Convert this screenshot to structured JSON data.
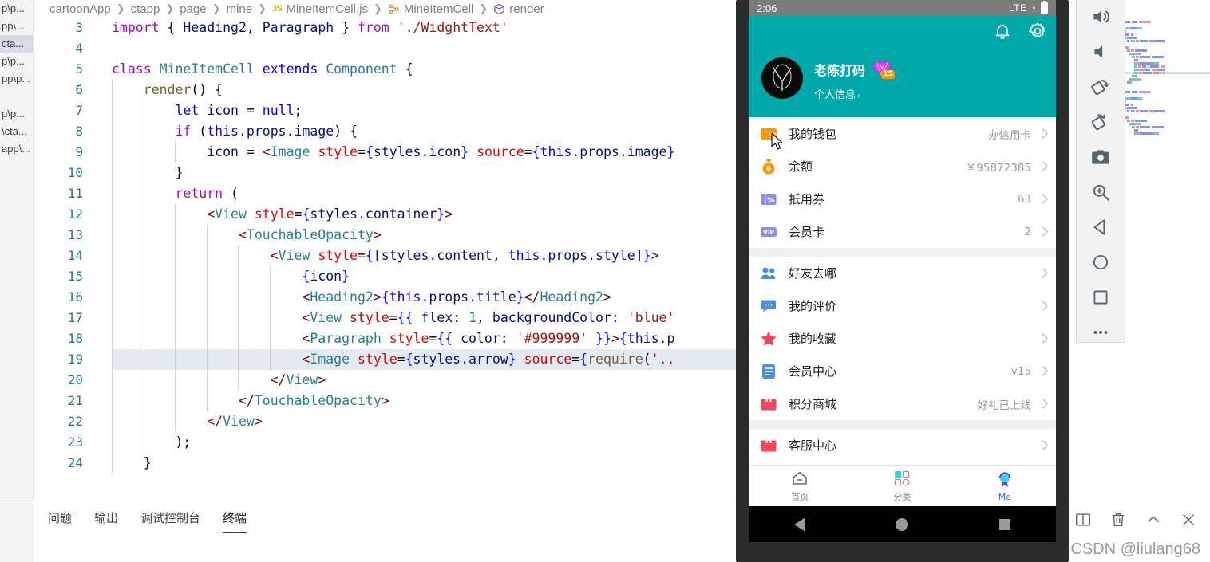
{
  "editor": {
    "breadcrumb": [
      {
        "label": "cartoonApp",
        "icon": ""
      },
      {
        "label": "ctapp",
        "icon": ""
      },
      {
        "label": "page",
        "icon": ""
      },
      {
        "label": "mine",
        "icon": ""
      },
      {
        "label": "MineItemCell.js",
        "icon": "js-file-icon"
      },
      {
        "label": "MineItemCell",
        "icon": "class-icon"
      },
      {
        "label": "render",
        "icon": "method-icon"
      }
    ],
    "explorer_items": [
      {
        "label": "p\\p...",
        "selected": false
      },
      {
        "label": "pp\\...",
        "selected": false
      },
      {
        "label": "cta...",
        "selected": true
      },
      {
        "label": "p\\p...",
        "selected": false
      },
      {
        "label": "pp\\p...",
        "selected": false
      },
      {
        "label": "",
        "selected": false
      },
      {
        "label": "p\\p...",
        "selected": false
      },
      {
        "label": "\\cta...",
        "selected": false
      },
      {
        "label": "app\\...",
        "selected": false
      }
    ],
    "lines": [
      {
        "num": "3",
        "indent": 0,
        "highlight": false,
        "tokens": [
          {
            "t": "import ",
            "c": "t-kw"
          },
          {
            "t": "{ ",
            "c": "t-plain"
          },
          {
            "t": "Heading2",
            "c": "t-ident"
          },
          {
            "t": ", ",
            "c": "t-plain"
          },
          {
            "t": "Paragraph",
            "c": "t-ident"
          },
          {
            "t": " } ",
            "c": "t-plain"
          },
          {
            "t": "from ",
            "c": "t-kw"
          },
          {
            "t": "'./WidghtText'",
            "c": "t-str"
          }
        ]
      },
      {
        "num": "4",
        "indent": 0,
        "highlight": false,
        "tokens": []
      },
      {
        "num": "5",
        "indent": 0,
        "highlight": false,
        "tokens": [
          {
            "t": "class ",
            "c": "t-kw"
          },
          {
            "t": "MineItemCell",
            "c": "t-type"
          },
          {
            "t": " extends ",
            "c": "t-kw2"
          },
          {
            "t": "Component",
            "c": "t-type"
          },
          {
            "t": " {",
            "c": "t-plain"
          }
        ]
      },
      {
        "num": "6",
        "indent": 1,
        "highlight": false,
        "tokens": [
          {
            "t": "    ",
            "c": "t-plain"
          },
          {
            "t": "render",
            "c": "t-fn"
          },
          {
            "t": "() {",
            "c": "t-plain"
          }
        ]
      },
      {
        "num": "7",
        "indent": 2,
        "highlight": false,
        "tokens": [
          {
            "t": "        ",
            "c": "t-plain"
          },
          {
            "t": "let ",
            "c": "t-blue"
          },
          {
            "t": "icon",
            "c": "t-ident"
          },
          {
            "t": " = ",
            "c": "t-plain"
          },
          {
            "t": "null",
            "c": "t-blue"
          },
          {
            "t": ";",
            "c": "t-plain"
          }
        ]
      },
      {
        "num": "8",
        "indent": 2,
        "highlight": false,
        "tokens": [
          {
            "t": "        ",
            "c": "t-plain"
          },
          {
            "t": "if ",
            "c": "t-kw"
          },
          {
            "t": "(",
            "c": "t-plain"
          },
          {
            "t": "this",
            "c": "t-blue"
          },
          {
            "t": ".props.image",
            "c": "t-ident"
          },
          {
            "t": ") {",
            "c": "t-plain"
          }
        ]
      },
      {
        "num": "9",
        "indent": 3,
        "highlight": false,
        "tokens": [
          {
            "t": "            ",
            "c": "t-plain"
          },
          {
            "t": "icon",
            "c": "t-ident"
          },
          {
            "t": " = ",
            "c": "t-plain"
          },
          {
            "t": "<",
            "c": "t-bracket"
          },
          {
            "t": "Image",
            "c": "t-tag"
          },
          {
            "t": " ",
            "c": "t-plain"
          },
          {
            "t": "style",
            "c": "t-attr"
          },
          {
            "t": "=",
            "c": "t-plain"
          },
          {
            "t": "{",
            "c": "t-blue"
          },
          {
            "t": "styles.icon",
            "c": "t-ident"
          },
          {
            "t": "}",
            "c": "t-blue"
          },
          {
            "t": " ",
            "c": "t-plain"
          },
          {
            "t": "source",
            "c": "t-attr"
          },
          {
            "t": "=",
            "c": "t-plain"
          },
          {
            "t": "{",
            "c": "t-blue"
          },
          {
            "t": "this",
            "c": "t-blue"
          },
          {
            "t": ".props.image",
            "c": "t-ident"
          },
          {
            "t": "}",
            "c": "t-blue"
          }
        ]
      },
      {
        "num": "10",
        "indent": 2,
        "highlight": false,
        "tokens": [
          {
            "t": "        }",
            "c": "t-plain"
          }
        ]
      },
      {
        "num": "11",
        "indent": 2,
        "highlight": false,
        "tokens": [
          {
            "t": "        ",
            "c": "t-plain"
          },
          {
            "t": "return ",
            "c": "t-kw"
          },
          {
            "t": "(",
            "c": "t-plain"
          }
        ]
      },
      {
        "num": "12",
        "indent": 3,
        "highlight": false,
        "tokens": [
          {
            "t": "            ",
            "c": "t-plain"
          },
          {
            "t": "<",
            "c": "t-bracket"
          },
          {
            "t": "View",
            "c": "t-tag"
          },
          {
            "t": " ",
            "c": "t-plain"
          },
          {
            "t": "style",
            "c": "t-attr"
          },
          {
            "t": "=",
            "c": "t-plain"
          },
          {
            "t": "{",
            "c": "t-blue"
          },
          {
            "t": "styles.container",
            "c": "t-ident"
          },
          {
            "t": "}",
            "c": "t-blue"
          },
          {
            "t": ">",
            "c": "t-bracket"
          }
        ]
      },
      {
        "num": "13",
        "indent": 4,
        "highlight": false,
        "tokens": [
          {
            "t": "                ",
            "c": "t-plain"
          },
          {
            "t": "<",
            "c": "t-bracket"
          },
          {
            "t": "TouchableOpacity",
            "c": "t-tag"
          },
          {
            "t": ">",
            "c": "t-bracket"
          }
        ]
      },
      {
        "num": "14",
        "indent": 5,
        "highlight": false,
        "tokens": [
          {
            "t": "                    ",
            "c": "t-plain"
          },
          {
            "t": "<",
            "c": "t-bracket"
          },
          {
            "t": "View",
            "c": "t-tag"
          },
          {
            "t": " ",
            "c": "t-plain"
          },
          {
            "t": "style",
            "c": "t-attr"
          },
          {
            "t": "=",
            "c": "t-plain"
          },
          {
            "t": "{[",
            "c": "t-blue"
          },
          {
            "t": "styles.content",
            "c": "t-ident"
          },
          {
            "t": ", ",
            "c": "t-plain"
          },
          {
            "t": "this",
            "c": "t-blue"
          },
          {
            "t": ".props.style",
            "c": "t-ident"
          },
          {
            "t": "]}",
            "c": "t-blue"
          },
          {
            "t": ">",
            "c": "t-bracket"
          }
        ]
      },
      {
        "num": "15",
        "indent": 6,
        "highlight": false,
        "tokens": [
          {
            "t": "                        ",
            "c": "t-plain"
          },
          {
            "t": "{",
            "c": "t-blue"
          },
          {
            "t": "icon",
            "c": "t-ident"
          },
          {
            "t": "}",
            "c": "t-blue"
          }
        ]
      },
      {
        "num": "16",
        "indent": 6,
        "highlight": false,
        "tokens": [
          {
            "t": "                        ",
            "c": "t-plain"
          },
          {
            "t": "<",
            "c": "t-bracket"
          },
          {
            "t": "Heading2",
            "c": "t-tag"
          },
          {
            "t": ">",
            "c": "t-bracket"
          },
          {
            "t": "{",
            "c": "t-blue"
          },
          {
            "t": "this",
            "c": "t-blue"
          },
          {
            "t": ".props.title",
            "c": "t-ident"
          },
          {
            "t": "}",
            "c": "t-blue"
          },
          {
            "t": "</",
            "c": "t-bracket"
          },
          {
            "t": "Heading2",
            "c": "t-tag"
          },
          {
            "t": ">",
            "c": "t-bracket"
          }
        ]
      },
      {
        "num": "17",
        "indent": 6,
        "highlight": false,
        "tokens": [
          {
            "t": "                        ",
            "c": "t-plain"
          },
          {
            "t": "<",
            "c": "t-bracket"
          },
          {
            "t": "View",
            "c": "t-tag"
          },
          {
            "t": " ",
            "c": "t-plain"
          },
          {
            "t": "style",
            "c": "t-attr"
          },
          {
            "t": "=",
            "c": "t-plain"
          },
          {
            "t": "{{ ",
            "c": "t-blue"
          },
          {
            "t": "flex",
            "c": "t-ident"
          },
          {
            "t": ": ",
            "c": "t-plain"
          },
          {
            "t": "1",
            "c": "t-num"
          },
          {
            "t": ", ",
            "c": "t-plain"
          },
          {
            "t": "backgroundColor",
            "c": "t-ident"
          },
          {
            "t": ": ",
            "c": "t-plain"
          },
          {
            "t": "'blue'",
            "c": "t-str"
          }
        ]
      },
      {
        "num": "18",
        "indent": 6,
        "highlight": false,
        "tokens": [
          {
            "t": "                        ",
            "c": "t-plain"
          },
          {
            "t": "<",
            "c": "t-bracket"
          },
          {
            "t": "Paragraph",
            "c": "t-tag"
          },
          {
            "t": " ",
            "c": "t-plain"
          },
          {
            "t": "style",
            "c": "t-attr"
          },
          {
            "t": "=",
            "c": "t-plain"
          },
          {
            "t": "{{ ",
            "c": "t-blue"
          },
          {
            "t": "color",
            "c": "t-ident"
          },
          {
            "t": ": ",
            "c": "t-plain"
          },
          {
            "t": "'#999999'",
            "c": "t-str"
          },
          {
            "t": " }}",
            "c": "t-blue"
          },
          {
            "t": ">",
            "c": "t-bracket"
          },
          {
            "t": "{",
            "c": "t-blue"
          },
          {
            "t": "this",
            "c": "t-blue"
          },
          {
            "t": ".p",
            "c": "t-ident"
          }
        ]
      },
      {
        "num": "19",
        "indent": 6,
        "highlight": true,
        "tokens": [
          {
            "t": "                        ",
            "c": "t-plain"
          },
          {
            "t": "<",
            "c": "t-bracket"
          },
          {
            "t": "Image",
            "c": "t-tag"
          },
          {
            "t": " ",
            "c": "t-plain"
          },
          {
            "t": "style",
            "c": "t-attr"
          },
          {
            "t": "=",
            "c": "t-plain"
          },
          {
            "t": "{",
            "c": "t-blue"
          },
          {
            "t": "styles.arrow",
            "c": "t-ident"
          },
          {
            "t": "}",
            "c": "t-blue"
          },
          {
            "t": " ",
            "c": "t-plain"
          },
          {
            "t": "source",
            "c": "t-attr"
          },
          {
            "t": "=",
            "c": "t-plain"
          },
          {
            "t": "{",
            "c": "t-blue"
          },
          {
            "t": "require",
            "c": "t-fn"
          },
          {
            "t": "(",
            "c": "t-plain"
          },
          {
            "t": "'..",
            "c": "t-str"
          }
        ]
      },
      {
        "num": "20",
        "indent": 5,
        "highlight": false,
        "tokens": [
          {
            "t": "                    ",
            "c": "t-plain"
          },
          {
            "t": "</",
            "c": "t-bracket"
          },
          {
            "t": "View",
            "c": "t-tag"
          },
          {
            "t": ">",
            "c": "t-bracket"
          }
        ]
      },
      {
        "num": "21",
        "indent": 4,
        "highlight": false,
        "tokens": [
          {
            "t": "                ",
            "c": "t-plain"
          },
          {
            "t": "</",
            "c": "t-bracket"
          },
          {
            "t": "TouchableOpacity",
            "c": "t-tag"
          },
          {
            "t": ">",
            "c": "t-bracket"
          }
        ]
      },
      {
        "num": "22",
        "indent": 3,
        "highlight": false,
        "tokens": [
          {
            "t": "            ",
            "c": "t-plain"
          },
          {
            "t": "</",
            "c": "t-bracket"
          },
          {
            "t": "View",
            "c": "t-tag"
          },
          {
            "t": ">",
            "c": "t-bracket"
          }
        ]
      },
      {
        "num": "23",
        "indent": 2,
        "highlight": false,
        "tokens": [
          {
            "t": "        );",
            "c": "t-plain"
          }
        ]
      },
      {
        "num": "24",
        "indent": 1,
        "highlight": false,
        "tokens": [
          {
            "t": "    }",
            "c": "t-plain"
          }
        ]
      }
    ]
  },
  "panel": {
    "tabs": [
      {
        "label": "问题",
        "active": false
      },
      {
        "label": "输出",
        "active": false
      },
      {
        "label": "调试控制台",
        "active": false
      },
      {
        "label": "终端",
        "active": true
      }
    ],
    "actions": [
      {
        "name": "split-terminal-icon"
      },
      {
        "name": "kill-terminal-icon"
      },
      {
        "name": "chevron-up-icon"
      },
      {
        "name": "close-icon"
      }
    ],
    "watermark": "CSDN @liulang68"
  },
  "emulator": {
    "status_bar": {
      "time": "2:06",
      "network": "LTE"
    },
    "app_header": {
      "username": "老陈打码",
      "vip_level": "15",
      "profile_link": "个人信息",
      "profile_arrow": "›",
      "bg_color": "#00a9a9",
      "icons": [
        {
          "name": "bell-icon"
        },
        {
          "name": "gear-icon"
        }
      ]
    },
    "groups": [
      {
        "rows": [
          {
            "icon": "wallet-icon",
            "icon_color": "#ff9800",
            "label": "我的钱包",
            "value": "办信用卡"
          },
          {
            "icon": "money-bag-icon",
            "icon_color": "#ff9800",
            "label": "余额",
            "value": "￥95872385"
          },
          {
            "icon": "coupon-icon",
            "icon_color": "#8a8fe8",
            "label": "抵用券",
            "value": "63"
          },
          {
            "icon": "vip-card-icon",
            "icon_color": "#8a8fe8",
            "label": "会员卡",
            "value": "2"
          }
        ]
      },
      {
        "rows": [
          {
            "icon": "friends-icon",
            "icon_color": "#4a90e2",
            "label": "好友去哪",
            "value": ""
          },
          {
            "icon": "comment-icon",
            "icon_color": "#4a90e2",
            "label": "我的评价",
            "value": ""
          },
          {
            "icon": "star-icon",
            "icon_color": "#f0455a",
            "label": "我的收藏",
            "value": ""
          },
          {
            "icon": "document-icon",
            "icon_color": "#4a90e2",
            "label": "会员中心",
            "value": "v15"
          },
          {
            "icon": "shop-icon",
            "icon_color": "#f0455a",
            "label": "积分商城",
            "value": "好礼已上线"
          }
        ]
      },
      {
        "rows": [
          {
            "icon": "service-icon",
            "icon_color": "#f0455a",
            "label": "客服中心",
            "value": ""
          }
        ]
      }
    ],
    "tabbar": [
      {
        "icon": "home-icon",
        "label": "首页",
        "active": false
      },
      {
        "icon": "category-icon",
        "label": "分类",
        "active": false
      },
      {
        "icon": "me-icon",
        "label": "Me",
        "active": true
      }
    ],
    "navbar": [
      {
        "name": "android-back-button"
      },
      {
        "name": "android-home-button"
      },
      {
        "name": "android-recents-button"
      }
    ]
  },
  "emulator_toolbar": [
    {
      "name": "volume-up-icon"
    },
    {
      "name": "volume-down-icon"
    },
    {
      "name": "rotate-left-icon"
    },
    {
      "name": "rotate-right-icon"
    },
    {
      "name": "screenshot-camera-icon"
    },
    {
      "name": "zoom-icon"
    },
    {
      "name": "back-icon"
    },
    {
      "name": "home-icon"
    },
    {
      "name": "overview-icon"
    },
    {
      "name": "more-icon"
    }
  ]
}
